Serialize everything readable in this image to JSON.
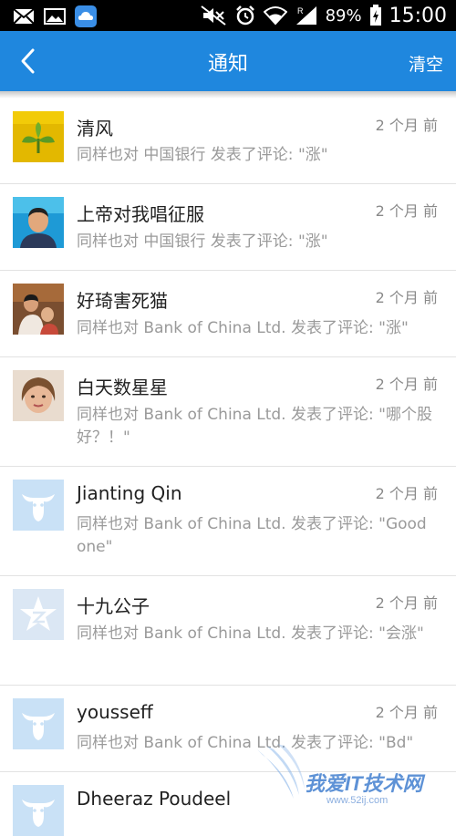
{
  "status_bar": {
    "battery": "89%",
    "time": "15:00"
  },
  "header": {
    "back_label": "",
    "title": "通知",
    "clear_label": "清空"
  },
  "notifications": [
    {
      "name": "清风",
      "time": "2 个月 前",
      "message": "同样也对 中国银行 发表了评论: \"涨\"",
      "avatar": "photo-plant"
    },
    {
      "name": "上帝对我唱征服",
      "time": "2 个月 前",
      "message": "同样也对 中国银行 发表了评论: \"涨\"",
      "avatar": "photo-man"
    },
    {
      "name": "好琦害死猫",
      "time": "2 个月 前",
      "message": "同样也对 Bank of China Ltd. 发表了评论: \"涨\"",
      "avatar": "photo-people"
    },
    {
      "name": "白天数星星",
      "time": "2 个月 前",
      "message": "同样也对 Bank of China Ltd. 发表了评论: \"哪个股好？！\"",
      "avatar": "photo-woman"
    },
    {
      "name": "Jianting Qin",
      "time": "2 个月 前",
      "message": "同样也对 Bank of China Ltd. 发表了评论: \"Good one\"",
      "avatar": "bull-icon"
    },
    {
      "name": "十九公子",
      "time": "2 个月 前",
      "message": "同样也对 Bank of China Ltd. 发表了评论: \"会涨\"",
      "avatar": "star-icon"
    },
    {
      "name": "yousseff",
      "time": "2 个月 前",
      "message": "同样也对 Bank of China Ltd. 发表了评论: \"Bd\"",
      "avatar": "bull-icon"
    },
    {
      "name": "Dheeraz Poudeel",
      "time": "",
      "message": "",
      "avatar": "bull-icon"
    }
  ],
  "watermark": {
    "text": "我爱IT技术网",
    "url": "www.52ij.com"
  },
  "colors": {
    "appbar": "#1f87de",
    "avatar_default": "#c9e1f6"
  }
}
